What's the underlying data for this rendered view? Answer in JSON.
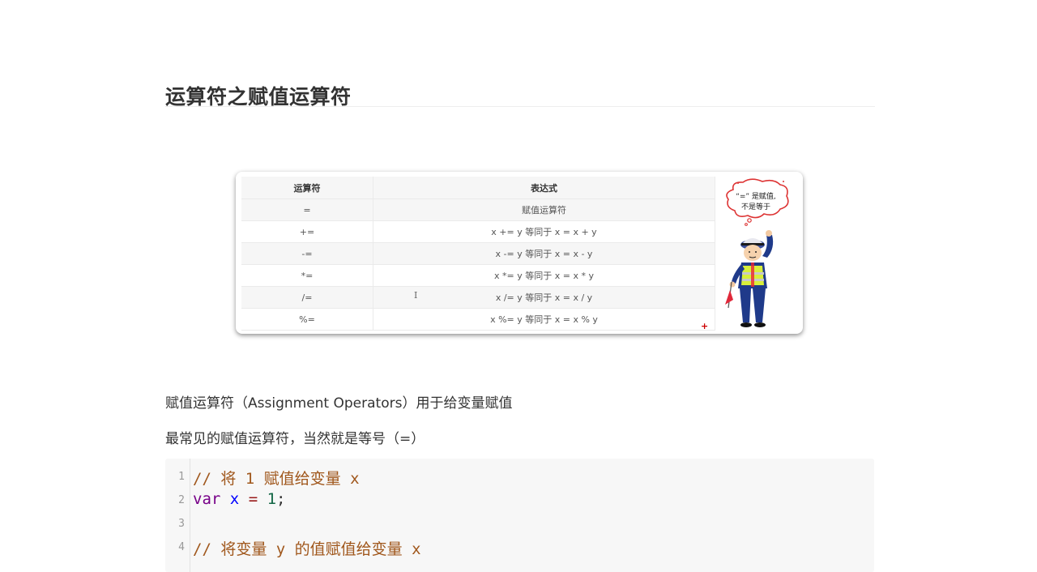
{
  "heading": "运算符之赋值运算符",
  "table": {
    "headers": [
      "运算符",
      "表达式"
    ],
    "rows": [
      [
        "=",
        "赋值运算符"
      ],
      [
        "+=",
        "x += y 等同于 x = x + y"
      ],
      [
        "-=",
        "x -= y 等同于 x = x - y"
      ],
      [
        "*=",
        "x *= y 等同于 x = x * y"
      ],
      [
        "/=",
        "x /= y 等同于 x = x / y"
      ],
      [
        "%=",
        "x %= y 等同于 x = x % y"
      ]
    ],
    "cursor_glyph": "I",
    "plus_mark": "+"
  },
  "bubble": {
    "line1": "“=” 是赋值,",
    "line2": "不是等于"
  },
  "paragraphs": {
    "p1": "赋值运算符（Assignment Operators）用于给变量赋值",
    "p2": "最常见的赋值运算符，当然就是等号（=）"
  },
  "code": {
    "lines": [
      {
        "n": "1",
        "comment": "// 将 1 赋值给变量 x"
      },
      {
        "n": "2",
        "kw": "var",
        "v": "x",
        "op": "=",
        "num": "1",
        "end": ";"
      },
      {
        "n": "3"
      },
      {
        "n": "4",
        "comment": "// 将变量 y 的值赋值给变量 x"
      }
    ]
  }
}
